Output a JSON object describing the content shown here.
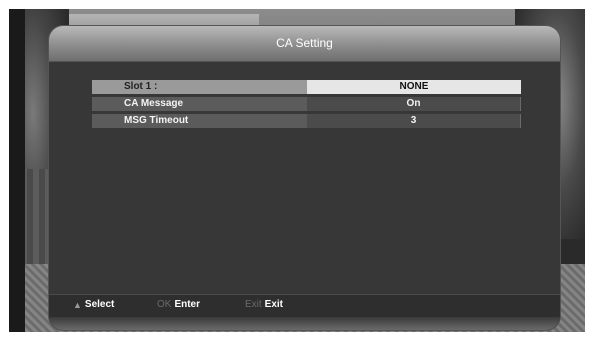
{
  "dialog": {
    "title": "CA Setting"
  },
  "settings": [
    {
      "label": "Slot 1 :",
      "value": "NONE",
      "selected": true
    },
    {
      "label": "CA Message",
      "value": "On",
      "selected": false
    },
    {
      "label": "MSG Timeout",
      "value": "3",
      "selected": false
    }
  ],
  "footer": {
    "select_icon": "up-down-arrows-icon",
    "select_label": "Select",
    "ok_key": "OK",
    "ok_label": "Enter",
    "exit_key": "Exit",
    "exit_label": "Exit"
  }
}
